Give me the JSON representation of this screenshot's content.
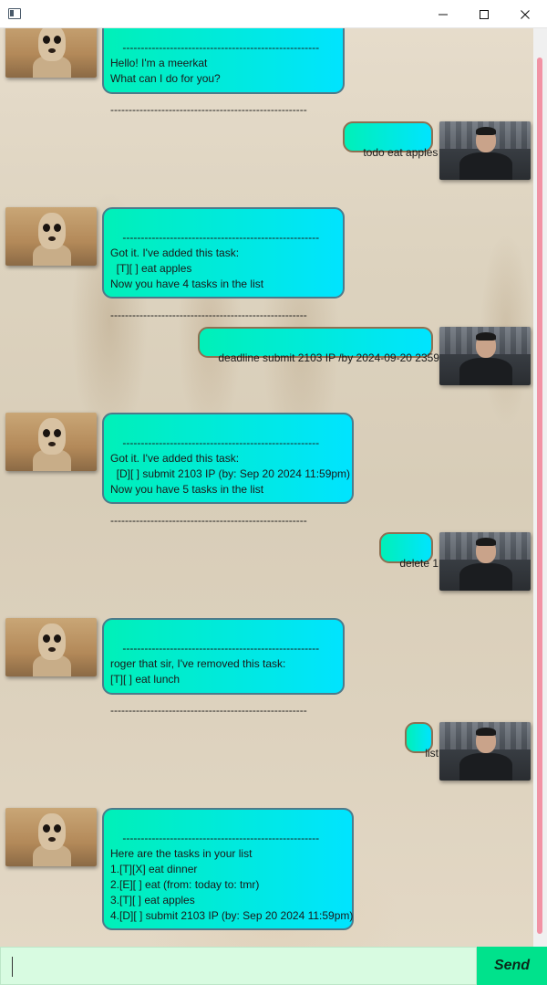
{
  "window": {
    "minimize_icon": "minimize-icon",
    "maximize_icon": "maximize-icon",
    "close_icon": "close-icon"
  },
  "messages": [
    {
      "sender": "bot",
      "text": "------------------------------------------------------\nHello! I'm a meerkat\nWhat can I do for you?\n\n------------------------------------------------------"
    },
    {
      "sender": "user",
      "text": "todo eat apples"
    },
    {
      "sender": "bot",
      "text": "------------------------------------------------------\nGot it. I've added this task:\n  [T][ ] eat apples\nNow you have 4 tasks in the list\n\n------------------------------------------------------"
    },
    {
      "sender": "user",
      "text": "deadline submit 2103 IP /by 2024-09-20 2359"
    },
    {
      "sender": "bot",
      "text": "------------------------------------------------------\nGot it. I've added this task:\n  [D][ ] submit 2103 IP (by: Sep 20 2024 11:59pm)\nNow you have 5 tasks in the list\n\n------------------------------------------------------"
    },
    {
      "sender": "user",
      "text": "delete 1"
    },
    {
      "sender": "bot",
      "text": "------------------------------------------------------\nroger that sir, I've removed this task:\n[T][ ] eat lunch\n\n------------------------------------------------------"
    },
    {
      "sender": "user",
      "text": "list"
    },
    {
      "sender": "bot",
      "text": "------------------------------------------------------\nHere are the tasks in your list\n1.[T][X] eat dinner\n2.[E][ ] eat (from: today to: tmr)\n3.[T][ ] eat apples\n4.[D][ ] submit 2103 IP (by: Sep 20 2024 11:59pm)\n\n------------------------------------------------------"
    }
  ],
  "input": {
    "value": ""
  },
  "send_button": {
    "label": "Send"
  },
  "colors": {
    "bubble_start": "#00f0b8",
    "bubble_end": "#00e4ff",
    "input_bg": "#d8fbe1",
    "send_bg": "#00e28c",
    "scroll_thumb": "#f292a4"
  }
}
